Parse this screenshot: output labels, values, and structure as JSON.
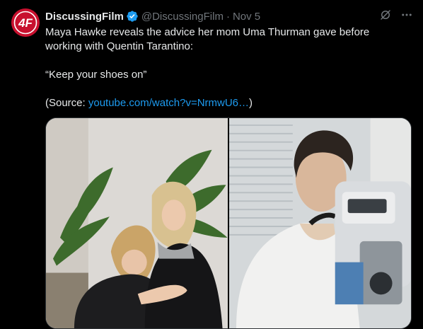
{
  "account": {
    "name": "DiscussingFilm",
    "handle": "@DiscussingFilm",
    "separator": "·",
    "date": "Nov 5",
    "avatar_text": "4F"
  },
  "tweet": {
    "line1": "Maya Hawke reveals the advice her mom Uma Thurman gave before working with Quentin Tarantino:",
    "quote": "“Keep your shoes on”",
    "source_prefix": "(Source: ",
    "source_link": "youtube.com/watch?v=NrmwU6…",
    "source_suffix": ")"
  },
  "icons": {
    "verified": "verified-badge-icon",
    "grok": "grok-icon",
    "more": "more-icon"
  },
  "colors": {
    "background": "#000000",
    "text": "#e7e9ea",
    "secondary": "#71767b",
    "link": "#1d9bf0",
    "verified": "#1d9bf0",
    "avatar": "#c8102e"
  }
}
